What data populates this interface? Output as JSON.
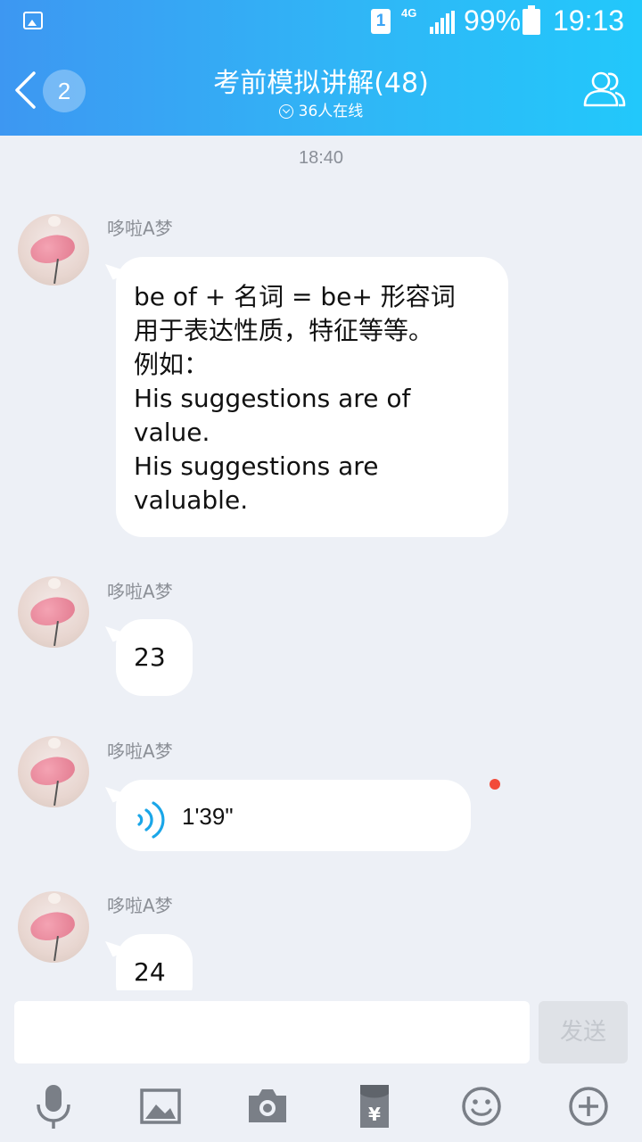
{
  "status_bar": {
    "sim_label": "1",
    "network_label": "4G",
    "battery_percent": "99%",
    "time": "19:13"
  },
  "header": {
    "unread_count": "2",
    "title": "考前模拟讲解(48)",
    "online": "36人在线"
  },
  "chat": {
    "timestamp": "18:40",
    "messages": [
      {
        "sender": "哆啦A梦",
        "text": "be of + 名词 = be+ 形容词\n用于表达性质，特征等等。\n例如：\nHis suggestions are of value.\nHis suggestions are valuable."
      },
      {
        "sender": "哆啦A梦",
        "text": "23"
      },
      {
        "sender": "哆啦A梦",
        "voice_duration": "1'39\"",
        "unread": true
      },
      {
        "sender": "哆啦A梦",
        "text": "24"
      }
    ]
  },
  "composer": {
    "input_value": "",
    "send_label": "发送"
  },
  "toolbar": [
    "microphone-icon",
    "image-icon",
    "camera-icon",
    "red-packet-icon",
    "emoji-icon",
    "plus-icon"
  ],
  "colors": {
    "header_gradient_start": "#3d97f2",
    "header_gradient_end": "#22c8fb",
    "background": "#edf0f6",
    "voice_accent": "#1aa6e8",
    "unread_dot": "#f24b3a"
  }
}
